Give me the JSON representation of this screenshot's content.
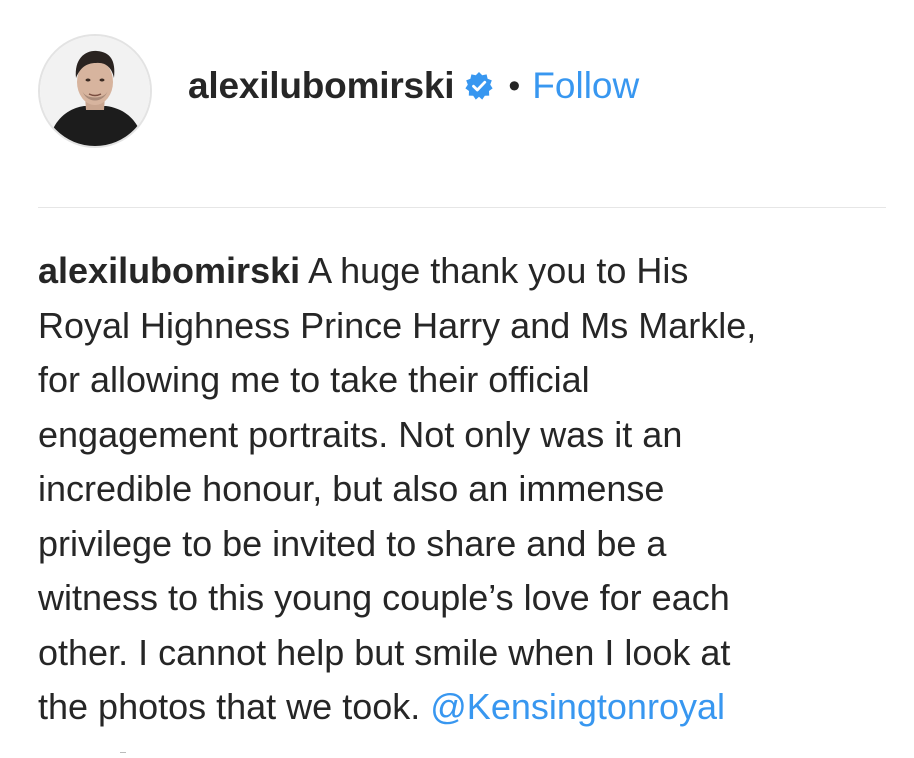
{
  "post_header": {
    "username": "alexilubomirski",
    "verified_icon": "verified-badge-icon",
    "separator": "•",
    "follow_label": "Follow",
    "avatar_icon": "profile-photo"
  },
  "caption": {
    "username": "alexilubomirski",
    "lines": [
      " A huge thank you to His",
      "Royal Highness Prince Harry and Ms Markle,",
      "for allowing me to take their official",
      "engagement portraits. Not only was it an",
      "incredible honour, but also an immense",
      "privilege to be invited to share and be a",
      "witness to this young couple’s love for each",
      "other.  I cannot help but smile when I look at",
      "the photos that we took. "
    ],
    "mention": "@Kensingtonroyal"
  },
  "colors": {
    "text": "#262626",
    "link": "#3897f0",
    "divider": "#e6e6e6",
    "verified": "#3897f0"
  }
}
